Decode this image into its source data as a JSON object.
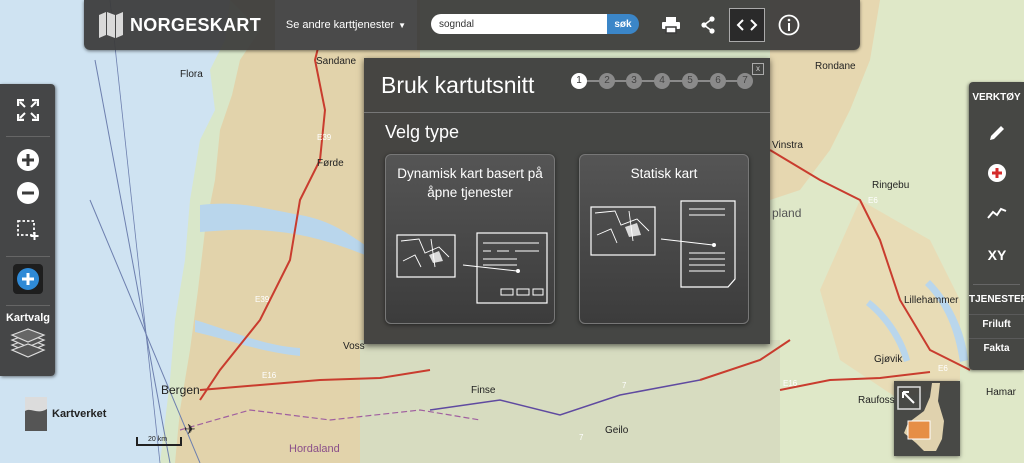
{
  "header": {
    "app_name": "NORGESKART",
    "services_label": "Se andre karttjenester",
    "search_value": "sogndal",
    "search_button": "søk"
  },
  "dialog": {
    "title": "Bruk kartutsnitt",
    "close": "x",
    "steps": [
      "1",
      "2",
      "3",
      "4",
      "5",
      "6",
      "7"
    ],
    "subtitle": "Velg type",
    "cards": [
      {
        "title": "Dynamisk kart basert på åpne tjenester"
      },
      {
        "title": "Statisk kart"
      }
    ]
  },
  "left_toolbar": {
    "kartvalg_label": "Kartvalg"
  },
  "right_toolbar": {
    "tools_label": "VERKTØY",
    "xy_label": "XY",
    "services_label": "TJENESTER",
    "friluft": "Friluft",
    "fakta": "Fakta"
  },
  "footer": {
    "kartverket": "Kartverket",
    "scale": "20 km"
  },
  "map_labels": [
    "Sandane",
    "Flora",
    "E39",
    "Førde",
    "E39",
    "Voss",
    "Bergen",
    "E16",
    "Finse",
    "Geilo",
    "Hordaland",
    "Rondane",
    "Vinstra",
    "Ringebu",
    "E6",
    "pland",
    "Lillehammer",
    "Gjøvik",
    "E16",
    "E6",
    "Raufoss",
    "Hamar",
    "7",
    "7"
  ],
  "colors": {
    "panel": "#3a3a3a",
    "search_button": "#3b86c8",
    "add_layer": "#2f8ad6",
    "map_base": "#d8e6c8",
    "fjord": "#b7d4ea"
  }
}
